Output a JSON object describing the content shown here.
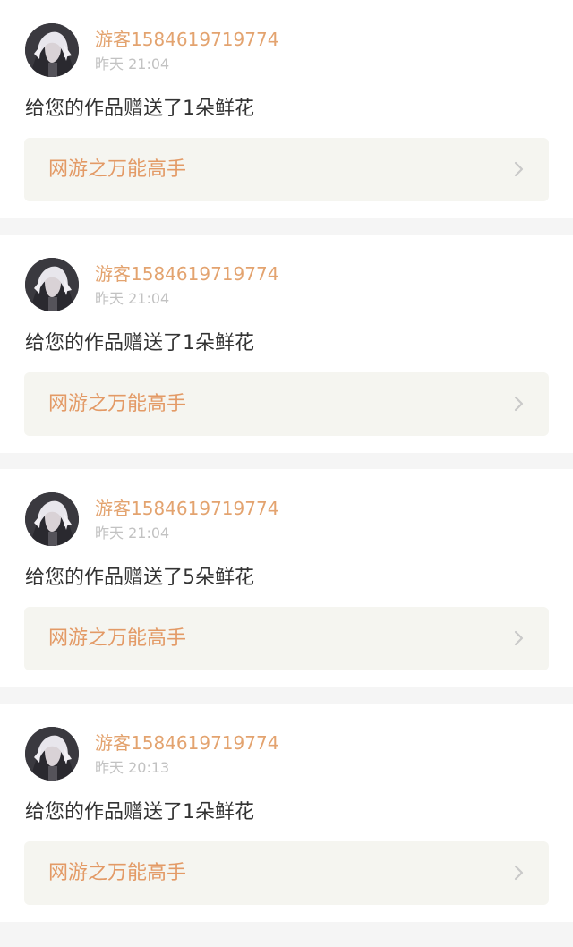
{
  "colors": {
    "username": "#e3a36f",
    "timestamp": "#c2c2c2",
    "message": "#333333",
    "work_title": "#e39a66",
    "link_background": "#f5f5f0",
    "page_background": "#f5f5f5"
  },
  "notifications": [
    {
      "avatar_icon": "anime-avatar",
      "username": "游客1584619719774",
      "time": "昨天 21:04",
      "message": "给您的作品赠送了1朵鲜花",
      "work_title": "网游之万能高手",
      "chevron_icon": "chevron-right-icon"
    },
    {
      "avatar_icon": "anime-avatar",
      "username": "游客1584619719774",
      "time": "昨天 21:04",
      "message": "给您的作品赠送了1朵鲜花",
      "work_title": "网游之万能高手",
      "chevron_icon": "chevron-right-icon"
    },
    {
      "avatar_icon": "anime-avatar",
      "username": "游客1584619719774",
      "time": "昨天 21:04",
      "message": "给您的作品赠送了5朵鲜花",
      "work_title": "网游之万能高手",
      "chevron_icon": "chevron-right-icon"
    },
    {
      "avatar_icon": "anime-avatar",
      "username": "游客1584619719774",
      "time": "昨天 20:13",
      "message": "给您的作品赠送了1朵鲜花",
      "work_title": "网游之万能高手",
      "chevron_icon": "chevron-right-icon"
    }
  ]
}
